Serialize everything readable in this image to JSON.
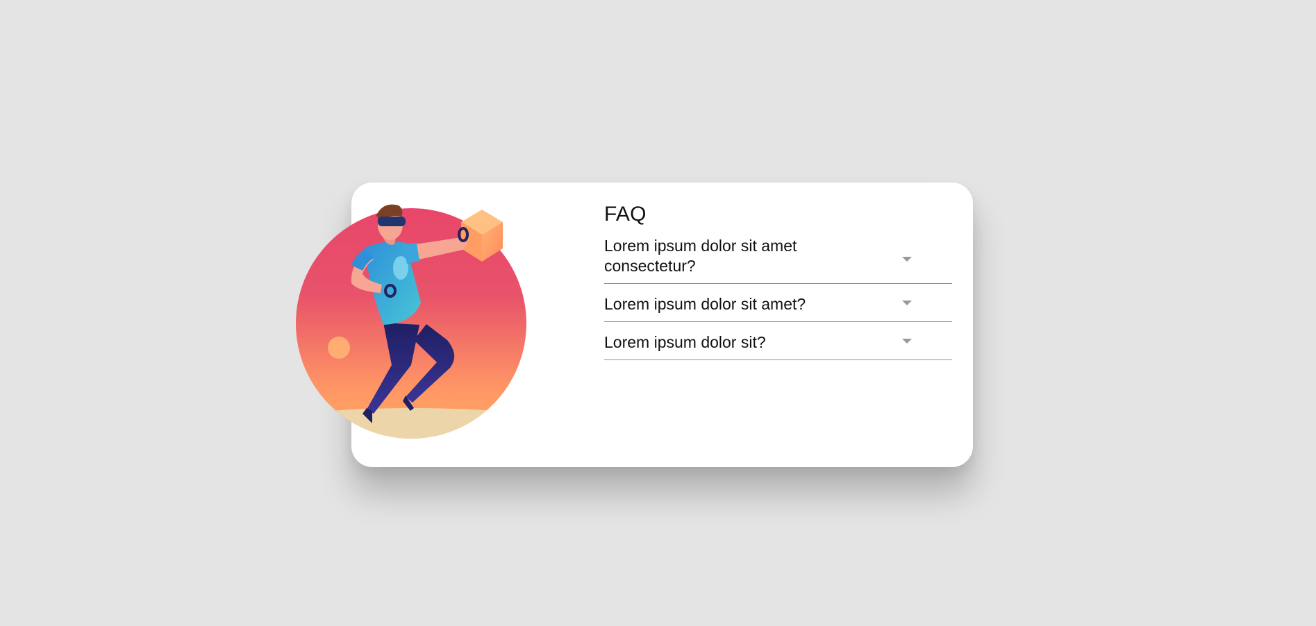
{
  "faq": {
    "title": "FAQ",
    "items": [
      {
        "question": "Lorem ipsum dolor sit amet consectetur?",
        "icon": "chevron-down-icon",
        "expanded": false
      },
      {
        "question": "Lorem ipsum dolor sit amet?",
        "icon": "chevron-down-icon",
        "expanded": false
      },
      {
        "question": "Lorem ipsum dolor sit?",
        "icon": "chevron-down-icon",
        "expanded": false
      }
    ]
  },
  "illustration": {
    "name": "vr-person-illustration"
  },
  "colors": {
    "background": "#e4e4e4",
    "card": "#ffffff",
    "circle_top": "#e8466a",
    "circle_bottom": "#ffa25f",
    "shirt": "#3fb3d8",
    "pants": "#2b2478",
    "divider": "#8e8e8e",
    "chevron": "#9a9a9a"
  }
}
